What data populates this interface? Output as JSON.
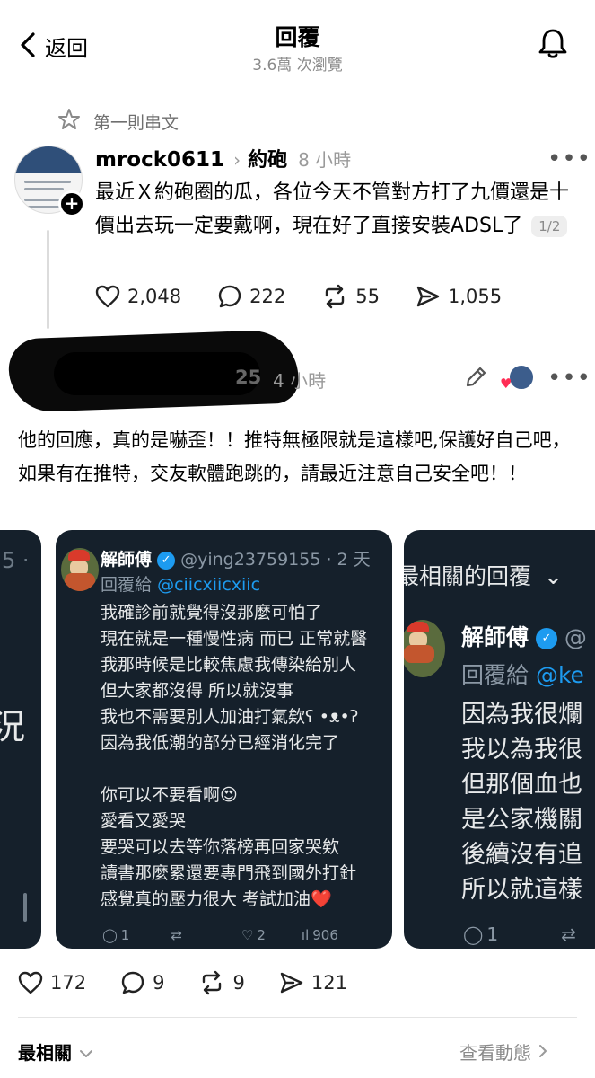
{
  "header": {
    "back_label": "返回",
    "title": "回覆",
    "views": "3.6萬 次瀏覽"
  },
  "thread_label": "第一則串文",
  "post1": {
    "username": "mrock0611",
    "tag": "約砲",
    "time": "8 小時",
    "text": "最近Ｘ約砲圈的瓜，各位今天不管對方打了九價還是十價出去玩一定要戴啊，現在好了直接安裝ADSL了",
    "pager": "1/2",
    "likes": "2,048",
    "replies": "222",
    "reposts": "55",
    "shares": "1,055"
  },
  "post2": {
    "username_tail": "25",
    "time": "4 小時",
    "text": "他的回應，真的是嚇歪！！推特無極限就是這樣吧,保護好自己吧，如果有在推特，交友軟體跑跳的，請最近注意自己安全吧！！",
    "likes": "172",
    "replies": "9",
    "reposts": "9",
    "shares": "121"
  },
  "screenshots": {
    "left": {
      "partial_top": "5 ·",
      "partial_char": "況"
    },
    "middle": {
      "name": "解師傅",
      "handle_time": "@ying23759155 · 2 天",
      "reply_to_label": "回覆給",
      "reply_to": "@ciicxiicxiic",
      "lines": [
        "我確診前就覺得沒那麼可怕了",
        "現在就是一種慢性病 而已 正常就醫",
        "我那時候是比較焦慮我傳染給別人",
        "但大家都沒得 所以就沒事",
        "我也不需要別人加油打氣欸ʕ •ᴥ•ʔ",
        "因為我低潮的部分已經消化完了",
        "",
        "你可以不要看啊😍",
        "愛看又愛哭",
        "要哭可以去等你落榜再回家哭欸",
        "讀書那麼累還要專門飛到國外打針",
        "感覺真的壓力很大 考試加油❤️"
      ],
      "stat_reply": "1",
      "stat_like": "2",
      "stat_views": "906"
    },
    "right": {
      "header": "最相關的回覆",
      "name": "解師傅",
      "handle": "@",
      "reply_to_label": "回覆給",
      "reply_to": "@ke",
      "lines": [
        "因為我很爛",
        "我以為我很",
        "但那個血也",
        "是公家機關",
        "後續沒有追",
        "所以就這樣"
      ],
      "stat_reply": "1"
    }
  },
  "footer": {
    "most_relevant": "最相關",
    "view_activity": "查看動態"
  },
  "colors": {
    "tweet_bg": "#15202b",
    "link_blue": "#1d9bf0",
    "muted": "#8a8a8a"
  }
}
